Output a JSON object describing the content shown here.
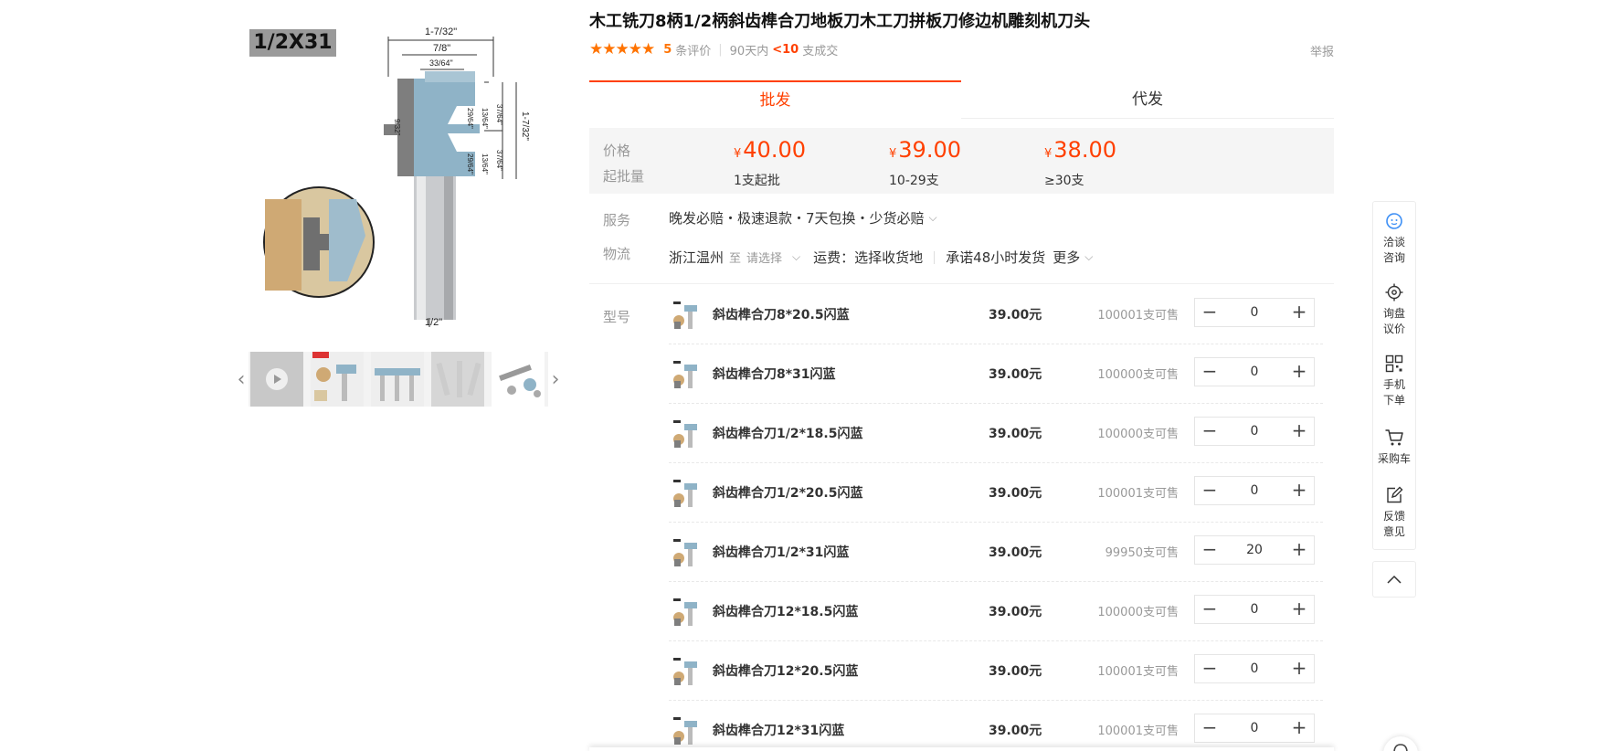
{
  "product": {
    "title": "木工铣刀8柄1/2柄斜齿榫合刀地板刀木工刀拼板刀修边机雕刻机刀头",
    "image_badge": "1/2X31",
    "stars": "★★★★★",
    "review_count": "5",
    "review_label": "条评价",
    "period_label": "90天内",
    "deal_count": "<10",
    "deal_label": "支成交",
    "report_label": "举报"
  },
  "diagram_labels": {
    "overall_width": "1-7/32\"",
    "width_2": "7/8\"",
    "width_3": "33/64\"",
    "height_a": "29/64\"",
    "height_b": "13/64\"",
    "height_c": "37/64\"",
    "height_total": "1-7/32\"",
    "left_dim": "9/32\"",
    "height_d": "29/64\"",
    "height_e": "13/64\"",
    "height_f": "37/64\"",
    "shank": "1/2\""
  },
  "tabs": [
    {
      "label": "批发",
      "active": true
    },
    {
      "label": "代发",
      "active": false
    }
  ],
  "pricing": {
    "price_label": "价格",
    "moq_label": "起批量",
    "currency": "¥",
    "tiers": [
      {
        "price": "40.00",
        "qty": "1支起批"
      },
      {
        "price": "39.00",
        "qty": "10-29支"
      },
      {
        "price": "38.00",
        "qty": "≥30支"
      }
    ]
  },
  "service": {
    "label": "服务",
    "text": "晚发必赔・极速退款・7天包换・少货必赔"
  },
  "logistics": {
    "label": "物流",
    "origin": "浙江温州",
    "to": "至",
    "destination_placeholder": "请选择",
    "shipping": "运费：选择收货地",
    "promise": "承诺48小时发货",
    "more": "更多"
  },
  "sku": {
    "label": "型号",
    "unit": "元",
    "items": [
      {
        "name": "斜齿榫合刀8*20.5闪蓝",
        "price": "39.00元",
        "stock": "100001支可售",
        "qty": "0"
      },
      {
        "name": "斜齿榫合刀8*31闪蓝",
        "price": "39.00元",
        "stock": "100000支可售",
        "qty": "0"
      },
      {
        "name": "斜齿榫合刀1/2*18.5闪蓝",
        "price": "39.00元",
        "stock": "100000支可售",
        "qty": "0"
      },
      {
        "name": "斜齿榫合刀1/2*20.5闪蓝",
        "price": "39.00元",
        "stock": "100001支可售",
        "qty": "0"
      },
      {
        "name": "斜齿榫合刀1/2*31闪蓝",
        "price": "39.00元",
        "stock": "99950支可售",
        "qty": "20"
      },
      {
        "name": "斜齿榫合刀12*18.5闪蓝",
        "price": "39.00元",
        "stock": "100000支可售",
        "qty": "0"
      },
      {
        "name": "斜齿榫合刀12*20.5闪蓝",
        "price": "39.00元",
        "stock": "100001支可售",
        "qty": "0"
      },
      {
        "name": "斜齿榫合刀12*31闪蓝",
        "price": "39.00元",
        "stock": "100001支可售",
        "qty": "0"
      }
    ]
  },
  "sidebar": {
    "items": [
      {
        "label1": "洽谈",
        "label2": "咨询",
        "icon": "chat-icon"
      },
      {
        "label1": "询盘",
        "label2": "议价",
        "icon": "target-icon"
      },
      {
        "label1": "手机",
        "label2": "下单",
        "icon": "qrcode-icon"
      },
      {
        "label1": "采购车",
        "label2": "",
        "icon": "cart-icon"
      },
      {
        "label1": "反馈",
        "label2": "意见",
        "icon": "edit-icon"
      }
    ]
  },
  "colors": {
    "accent": "#ff4000",
    "star": "#ff7300",
    "price_bg": "#f5f5f5",
    "sidebar_icon_blue": "#3d8ff5"
  }
}
